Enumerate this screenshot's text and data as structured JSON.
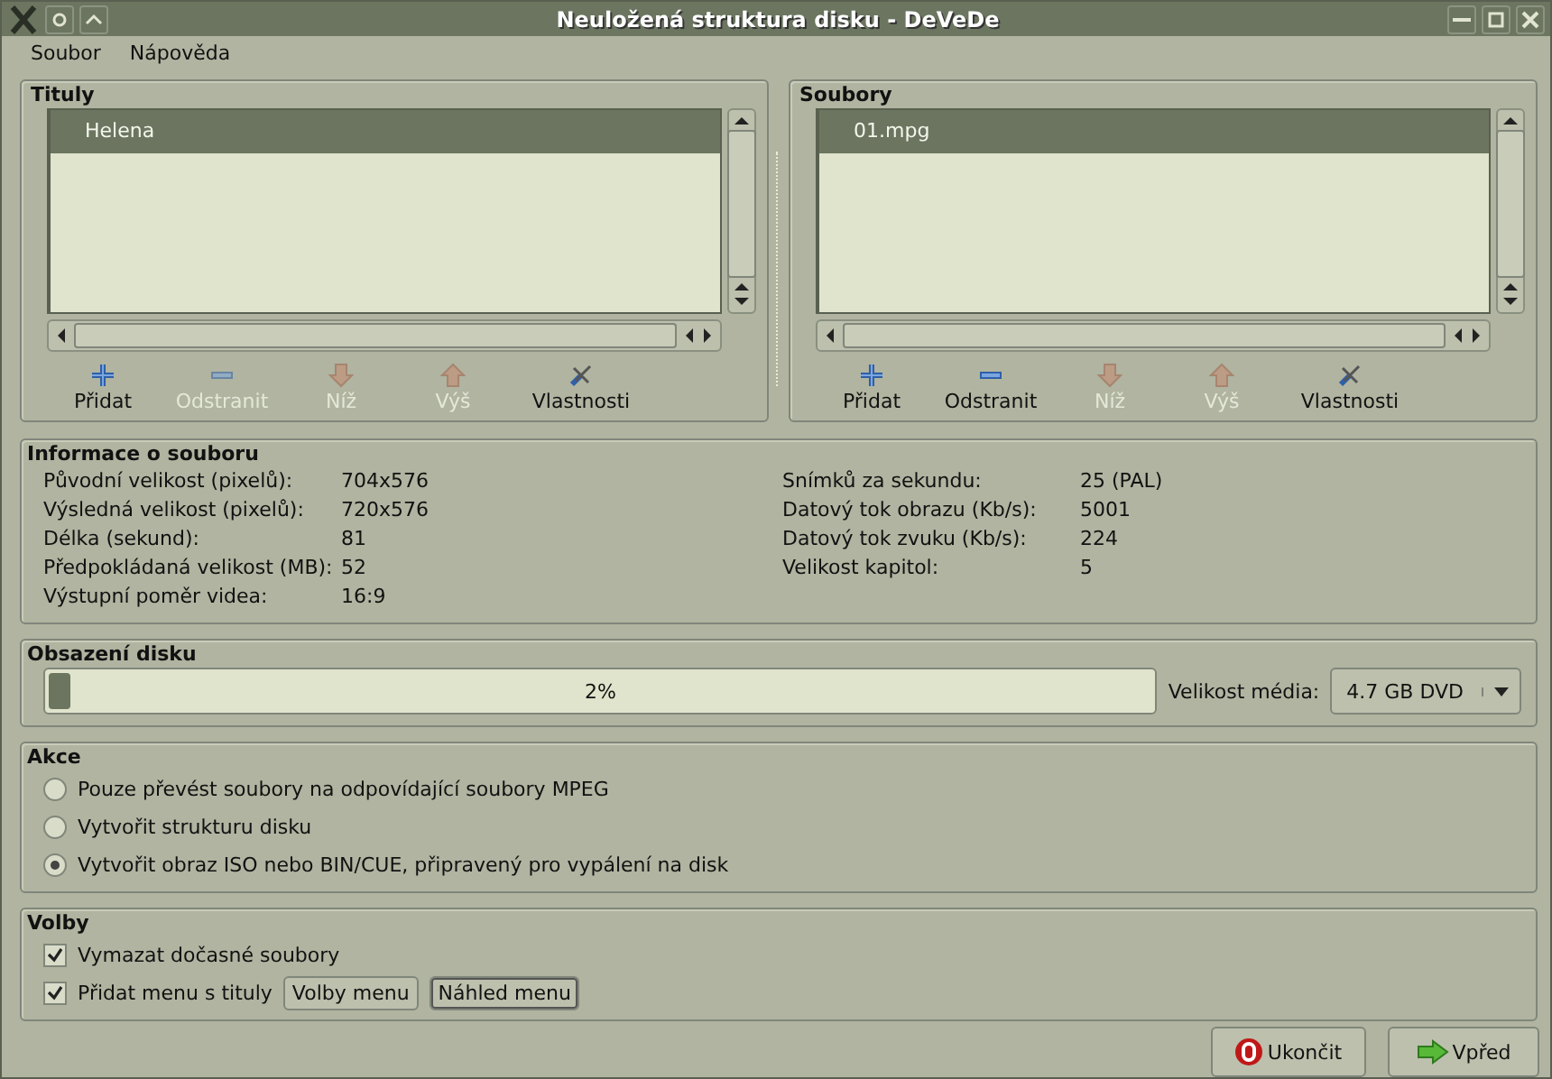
{
  "window": {
    "title": "Neuložená struktura disku - DeVeDe"
  },
  "menu": [
    "Soubor",
    "Nápověda"
  ],
  "panes": [
    {
      "title": "Tituly",
      "items": [
        {
          "label": "Helena",
          "selected": true
        }
      ],
      "tools": [
        {
          "kind": "add",
          "label": "Přidat",
          "disabled": false
        },
        {
          "kind": "remove",
          "label": "Odstranit",
          "disabled": true
        },
        {
          "kind": "down",
          "label": "Níž",
          "disabled": true
        },
        {
          "kind": "up",
          "label": "Výš",
          "disabled": true
        },
        {
          "kind": "props",
          "label": "Vlastnosti",
          "disabled": false
        }
      ]
    },
    {
      "title": "Soubory",
      "items": [
        {
          "label": "01.mpg",
          "selected": true
        }
      ],
      "tools": [
        {
          "kind": "add",
          "label": "Přidat",
          "disabled": false
        },
        {
          "kind": "remove",
          "label": "Odstranit",
          "disabled": false
        },
        {
          "kind": "down",
          "label": "Níž",
          "disabled": true
        },
        {
          "kind": "up",
          "label": "Výš",
          "disabled": true
        },
        {
          "kind": "props",
          "label": "Vlastnosti",
          "disabled": false
        }
      ]
    }
  ],
  "file_info": {
    "title": "Informace o souboru",
    "columns": [
      [
        {
          "label": "Původní velikost (pixelů):",
          "value": "704x576"
        },
        {
          "label": "Výsledná velikost (pixelů):",
          "value": "720x576"
        },
        {
          "label": "Délka (sekund):",
          "value": "81"
        },
        {
          "label": "Předpokládaná velikost (MB):",
          "value": "52"
        },
        {
          "label": "Výstupní poměr videa:",
          "value": "16:9"
        }
      ],
      [
        {
          "label": "Snímků za sekundu:",
          "value": "25 (PAL)"
        },
        {
          "label": "Datový tok obrazu (Kb/s):",
          "value": "5001"
        },
        {
          "label": "Datový tok zvuku (Kb/s):",
          "value": "224"
        },
        {
          "label": "Velikost kapitol:",
          "value": "5"
        }
      ]
    ]
  },
  "disk": {
    "title": "Obsazení disku",
    "level": 0.02,
    "reading": "2%",
    "media_label": "Velikost média:",
    "media_value": "4.7 GB DVD"
  },
  "actions": {
    "title": "Akce",
    "options": [
      {
        "label": "Pouze převést soubory na odpovídající soubory MPEG",
        "selected": false
      },
      {
        "label": "Vytvořit strukturu disku",
        "selected": false
      },
      {
        "label": "Vytvořit obraz ISO nebo BIN/CUE, připravený pro vypálení na disk",
        "selected": true
      }
    ]
  },
  "options": {
    "title": "Volby",
    "checks": [
      {
        "label": "Vymazat dočasné soubory",
        "checked": true
      },
      {
        "label": "Přidat menu s tituly",
        "checked": true
      }
    ],
    "buttons": [
      "Volby menu",
      "Náhled menu"
    ]
  },
  "footer": [
    {
      "kind": "quit",
      "label": "Ukončit"
    },
    {
      "kind": "forward",
      "label": "Vpřed"
    }
  ]
}
